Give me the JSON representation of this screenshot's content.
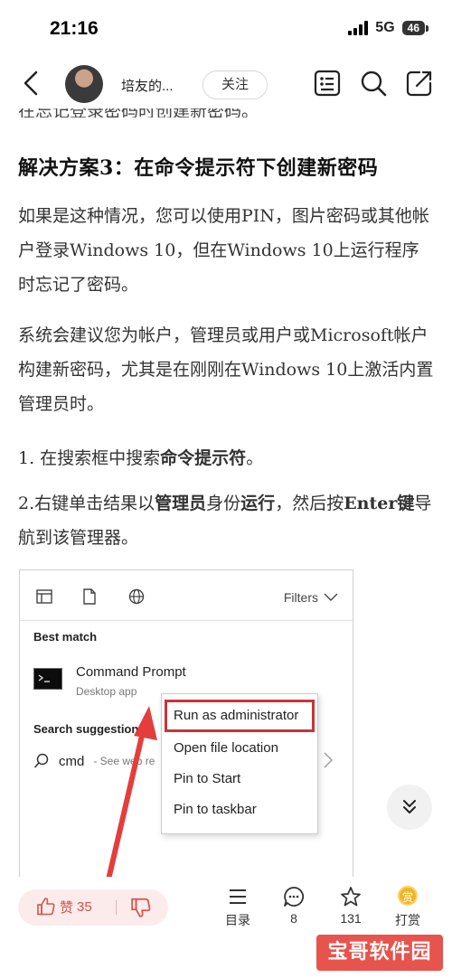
{
  "status": {
    "time": "21:16",
    "network": "5G",
    "battery": "46"
  },
  "nav": {
    "author": "培友的...",
    "follow_label": "关注"
  },
  "article": {
    "cut_line": "在忘记登录密码时创建新密码。",
    "heading": "解决方案3：在命令提示符下创建新密码",
    "para1": "如果是这种情况，您可以使用PIN，图片密码或其他帐户登录Windows 10，但在Windows 10上运行程序时忘记了密码。",
    "para2": "系统会建议您为帐户，管理员或用户或Microsoft帐户构建新密码，尤其是在刚刚在Windows 10上激活内置管理员时。",
    "step1_prefix": "1. 在搜索框中搜索",
    "step1_bold": "命令提示符",
    "step1_suffix": "。",
    "step2_prefix": "2.右键单击结果以",
    "step2_bold1": "管理员",
    "step2_mid1": "身份",
    "step2_bold2": "运行",
    "step2_mid2": "，然后按",
    "step2_bold3": "Enter键",
    "step2_suffix": "导航到该管理器。"
  },
  "screenshot": {
    "filters_label": "Filters",
    "best_match": "Best match",
    "app_title": "Command Prompt",
    "app_subtitle": "Desktop app",
    "suggestions_label": "Search suggestions",
    "suggestion_query": "cmd",
    "suggestion_hint": "- See web re",
    "context_menu": [
      "Run as administrator",
      "Open file location",
      "Pin to Start",
      "Pin to taskbar"
    ],
    "highlight_color": "#c7353a"
  },
  "bottom": {
    "like_label": "赞",
    "like_count": "35",
    "toc_label": "目录",
    "comment_count": "8",
    "favorite_count": "131",
    "tip_label": "打赏",
    "tip_icon_char": "赏"
  },
  "watermark": "宝哥软件园",
  "colors": {
    "accent": "#d2544c",
    "pill_bg": "#fbeceb"
  }
}
